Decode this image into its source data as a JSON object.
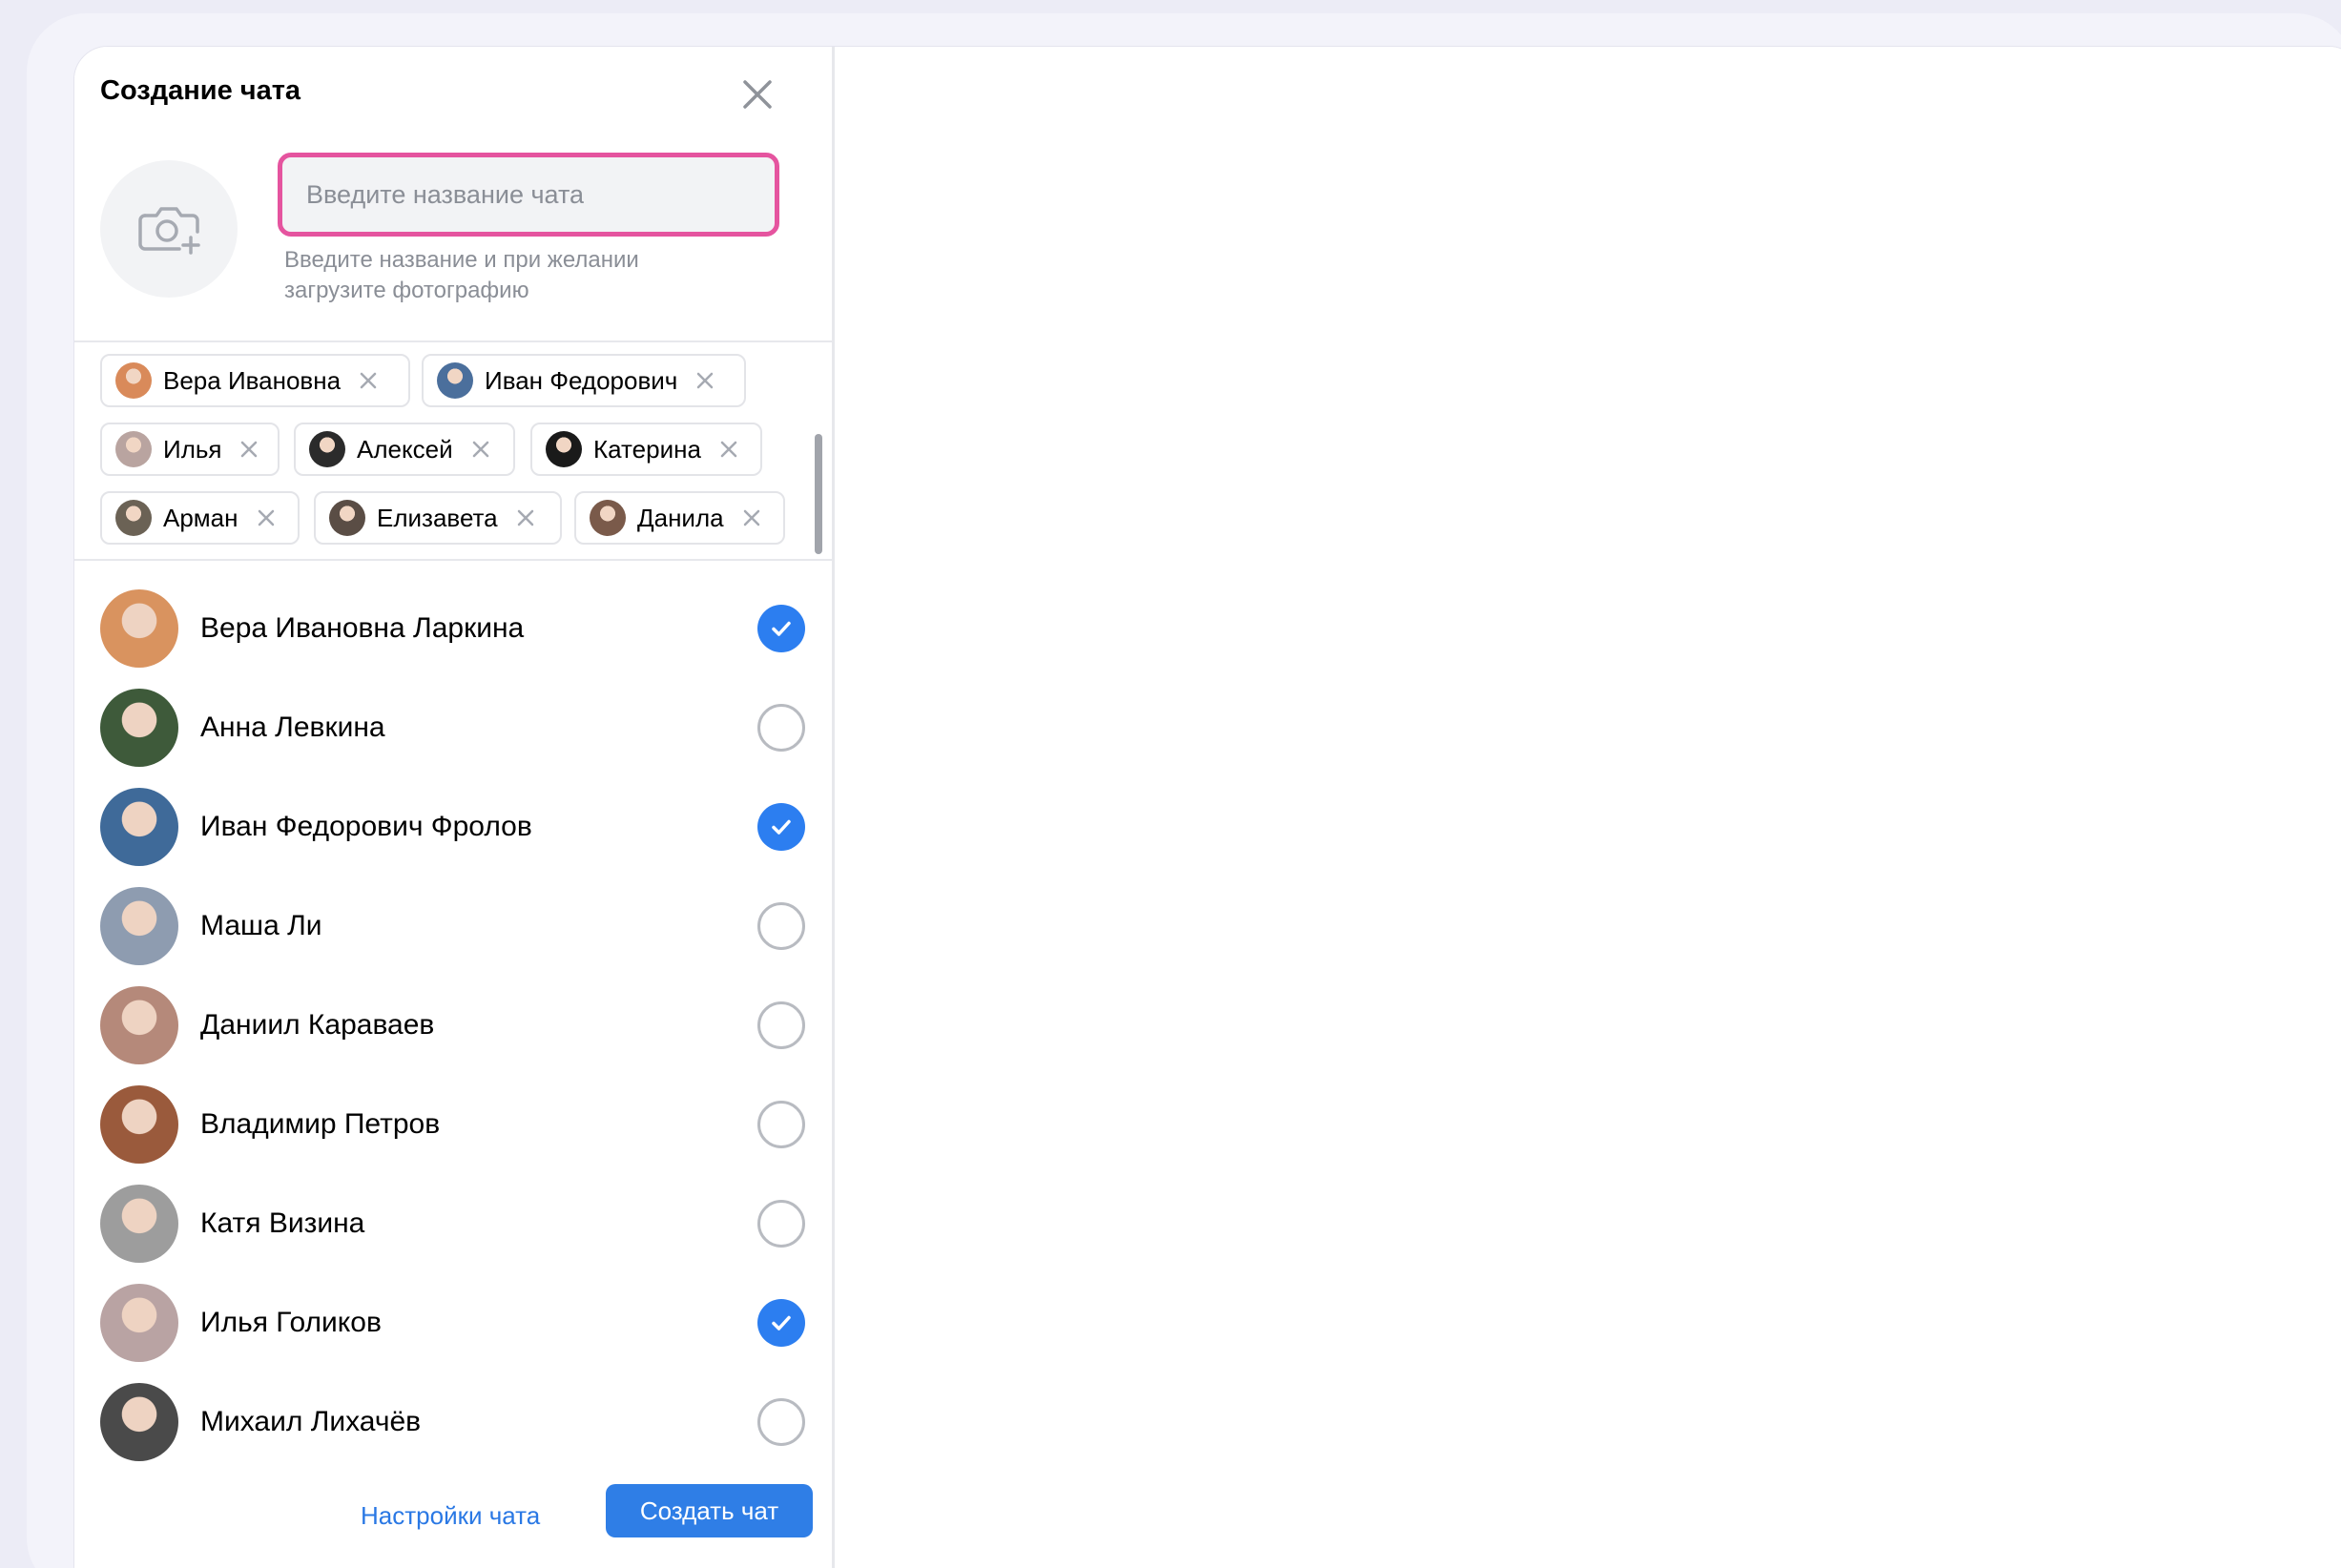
{
  "dialog": {
    "title": "Создание чата",
    "close_icon": "close-icon",
    "photo_icon": "camera-plus-icon",
    "name_input": {
      "value": "",
      "placeholder": "Введите название чата"
    },
    "hint": "Введите название и при желании загрузите фотографию"
  },
  "chips": [
    {
      "label": "Вера Ивановна",
      "avatar_color": "#d98a5a"
    },
    {
      "label": "Иван Федорович",
      "avatar_color": "#4b6f9c"
    },
    {
      "label": "Илья",
      "avatar_color": "#b9a4a0"
    },
    {
      "label": "Алексей",
      "avatar_color": "#2b2b2b"
    },
    {
      "label": "Катерина",
      "avatar_color": "#1a1a1a"
    },
    {
      "label": "Арман",
      "avatar_color": "#6b6255"
    },
    {
      "label": "Елизавета",
      "avatar_color": "#5a4d45"
    },
    {
      "label": "Данила",
      "avatar_color": "#7a5a4a"
    }
  ],
  "contacts": [
    {
      "name": "Вера Ивановна Ларкина",
      "selected": true,
      "avatar_color": "#d9935f"
    },
    {
      "name": "Анна Левкина",
      "selected": false,
      "avatar_color": "#3e5a3a"
    },
    {
      "name": "Иван Федорович Фролов",
      "selected": true,
      "avatar_color": "#3f6a99"
    },
    {
      "name": "Маша Ли",
      "selected": false,
      "avatar_color": "#8e9cb0"
    },
    {
      "name": "Даниил Караваев",
      "selected": false,
      "avatar_color": "#b5897a"
    },
    {
      "name": "Владимир Петров",
      "selected": false,
      "avatar_color": "#9a5a3c"
    },
    {
      "name": "Катя Визина",
      "selected": false,
      "avatar_color": "#9d9d9d"
    },
    {
      "name": "Илья Голиков",
      "selected": true,
      "avatar_color": "#b9a3a3"
    },
    {
      "name": "Михаил Лихачёв",
      "selected": false,
      "avatar_color": "#4a4a4a"
    }
  ],
  "footer": {
    "settings_label": "Настройки чата",
    "create_label": "Создать чат"
  },
  "colors": {
    "accent": "#2c7ef0",
    "input_highlight": "#e5549f",
    "secondary_text": "#8a8e96"
  }
}
